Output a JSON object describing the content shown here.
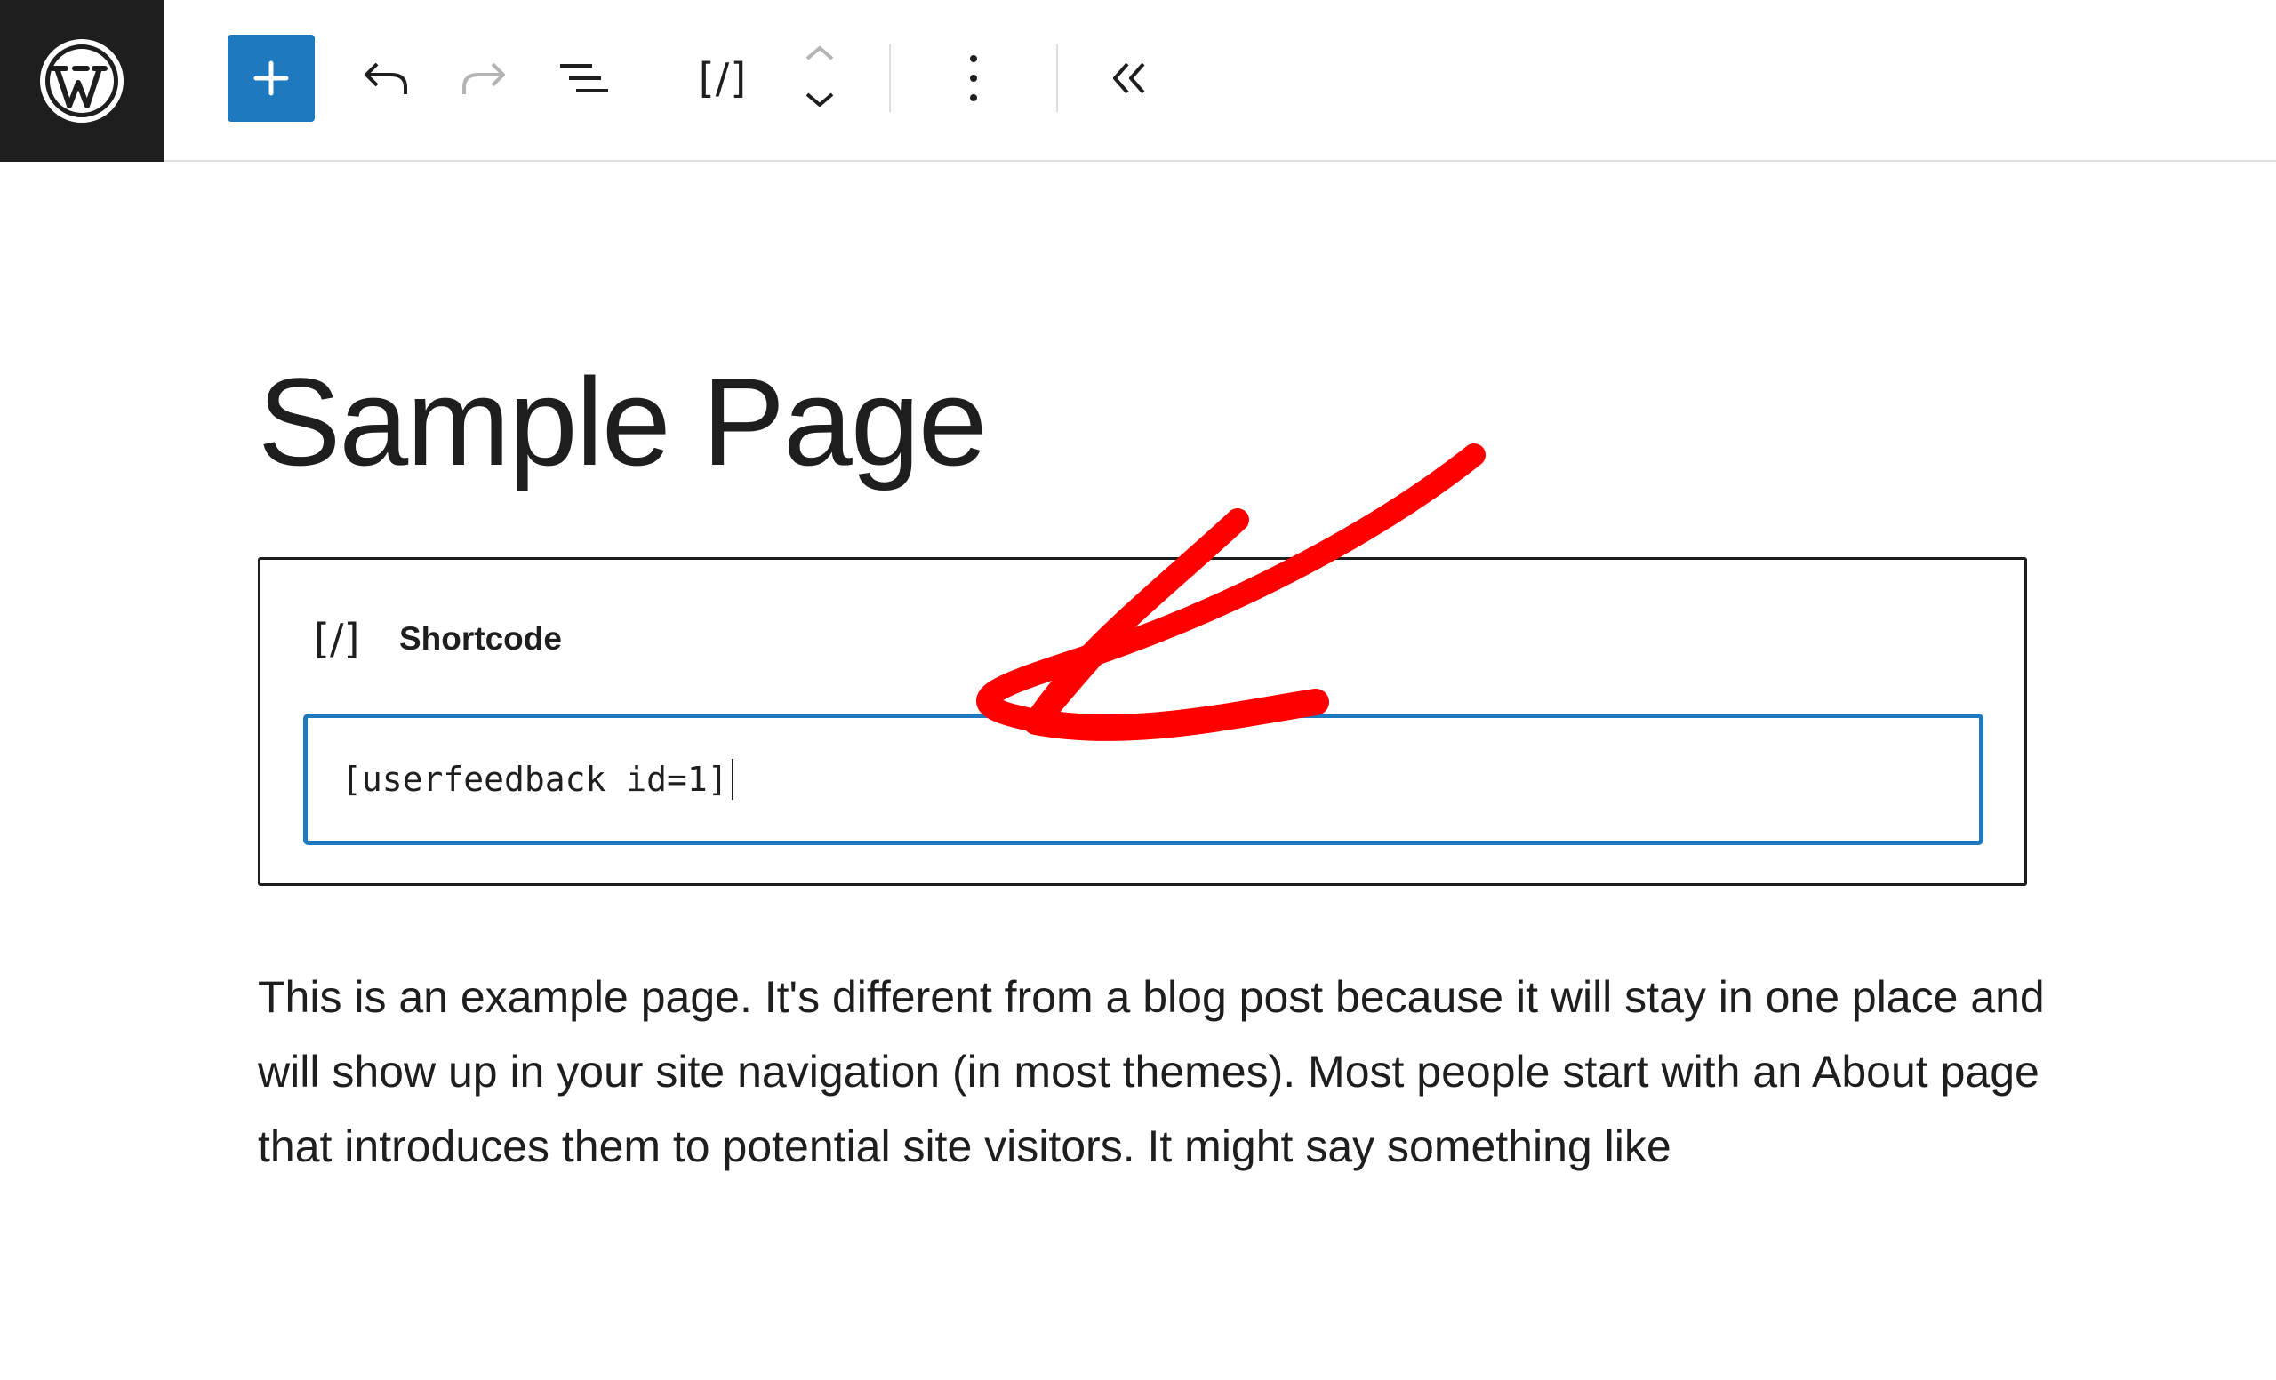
{
  "toolbar": {
    "logo_icon": "wordpress-logo-icon",
    "add_icon": "plus-icon",
    "undo_icon": "undo-icon",
    "redo_icon": "redo-icon",
    "list_view_icon": "list-view-icon",
    "block_icon": "[/]",
    "move_icon": "move-up-down-icon",
    "options_icon": "more-vertical-icon",
    "collapse_icon": "chevron-double-left-icon",
    "accent": "#1e79be"
  },
  "page": {
    "title": "Sample Page",
    "shortcode_block": {
      "icon": "[/]",
      "label": "Shortcode",
      "value": "[userfeedback id=1]"
    },
    "paragraph": "This is an example page. It's different from a blog post because it will stay in one place and will show up in your site navigation (in most themes). Most people start with an About page that introduces them to potential site visitors. It might say something like"
  },
  "annotation": {
    "type": "arrow",
    "color": "#ff0000",
    "points_to": "shortcode-input"
  }
}
